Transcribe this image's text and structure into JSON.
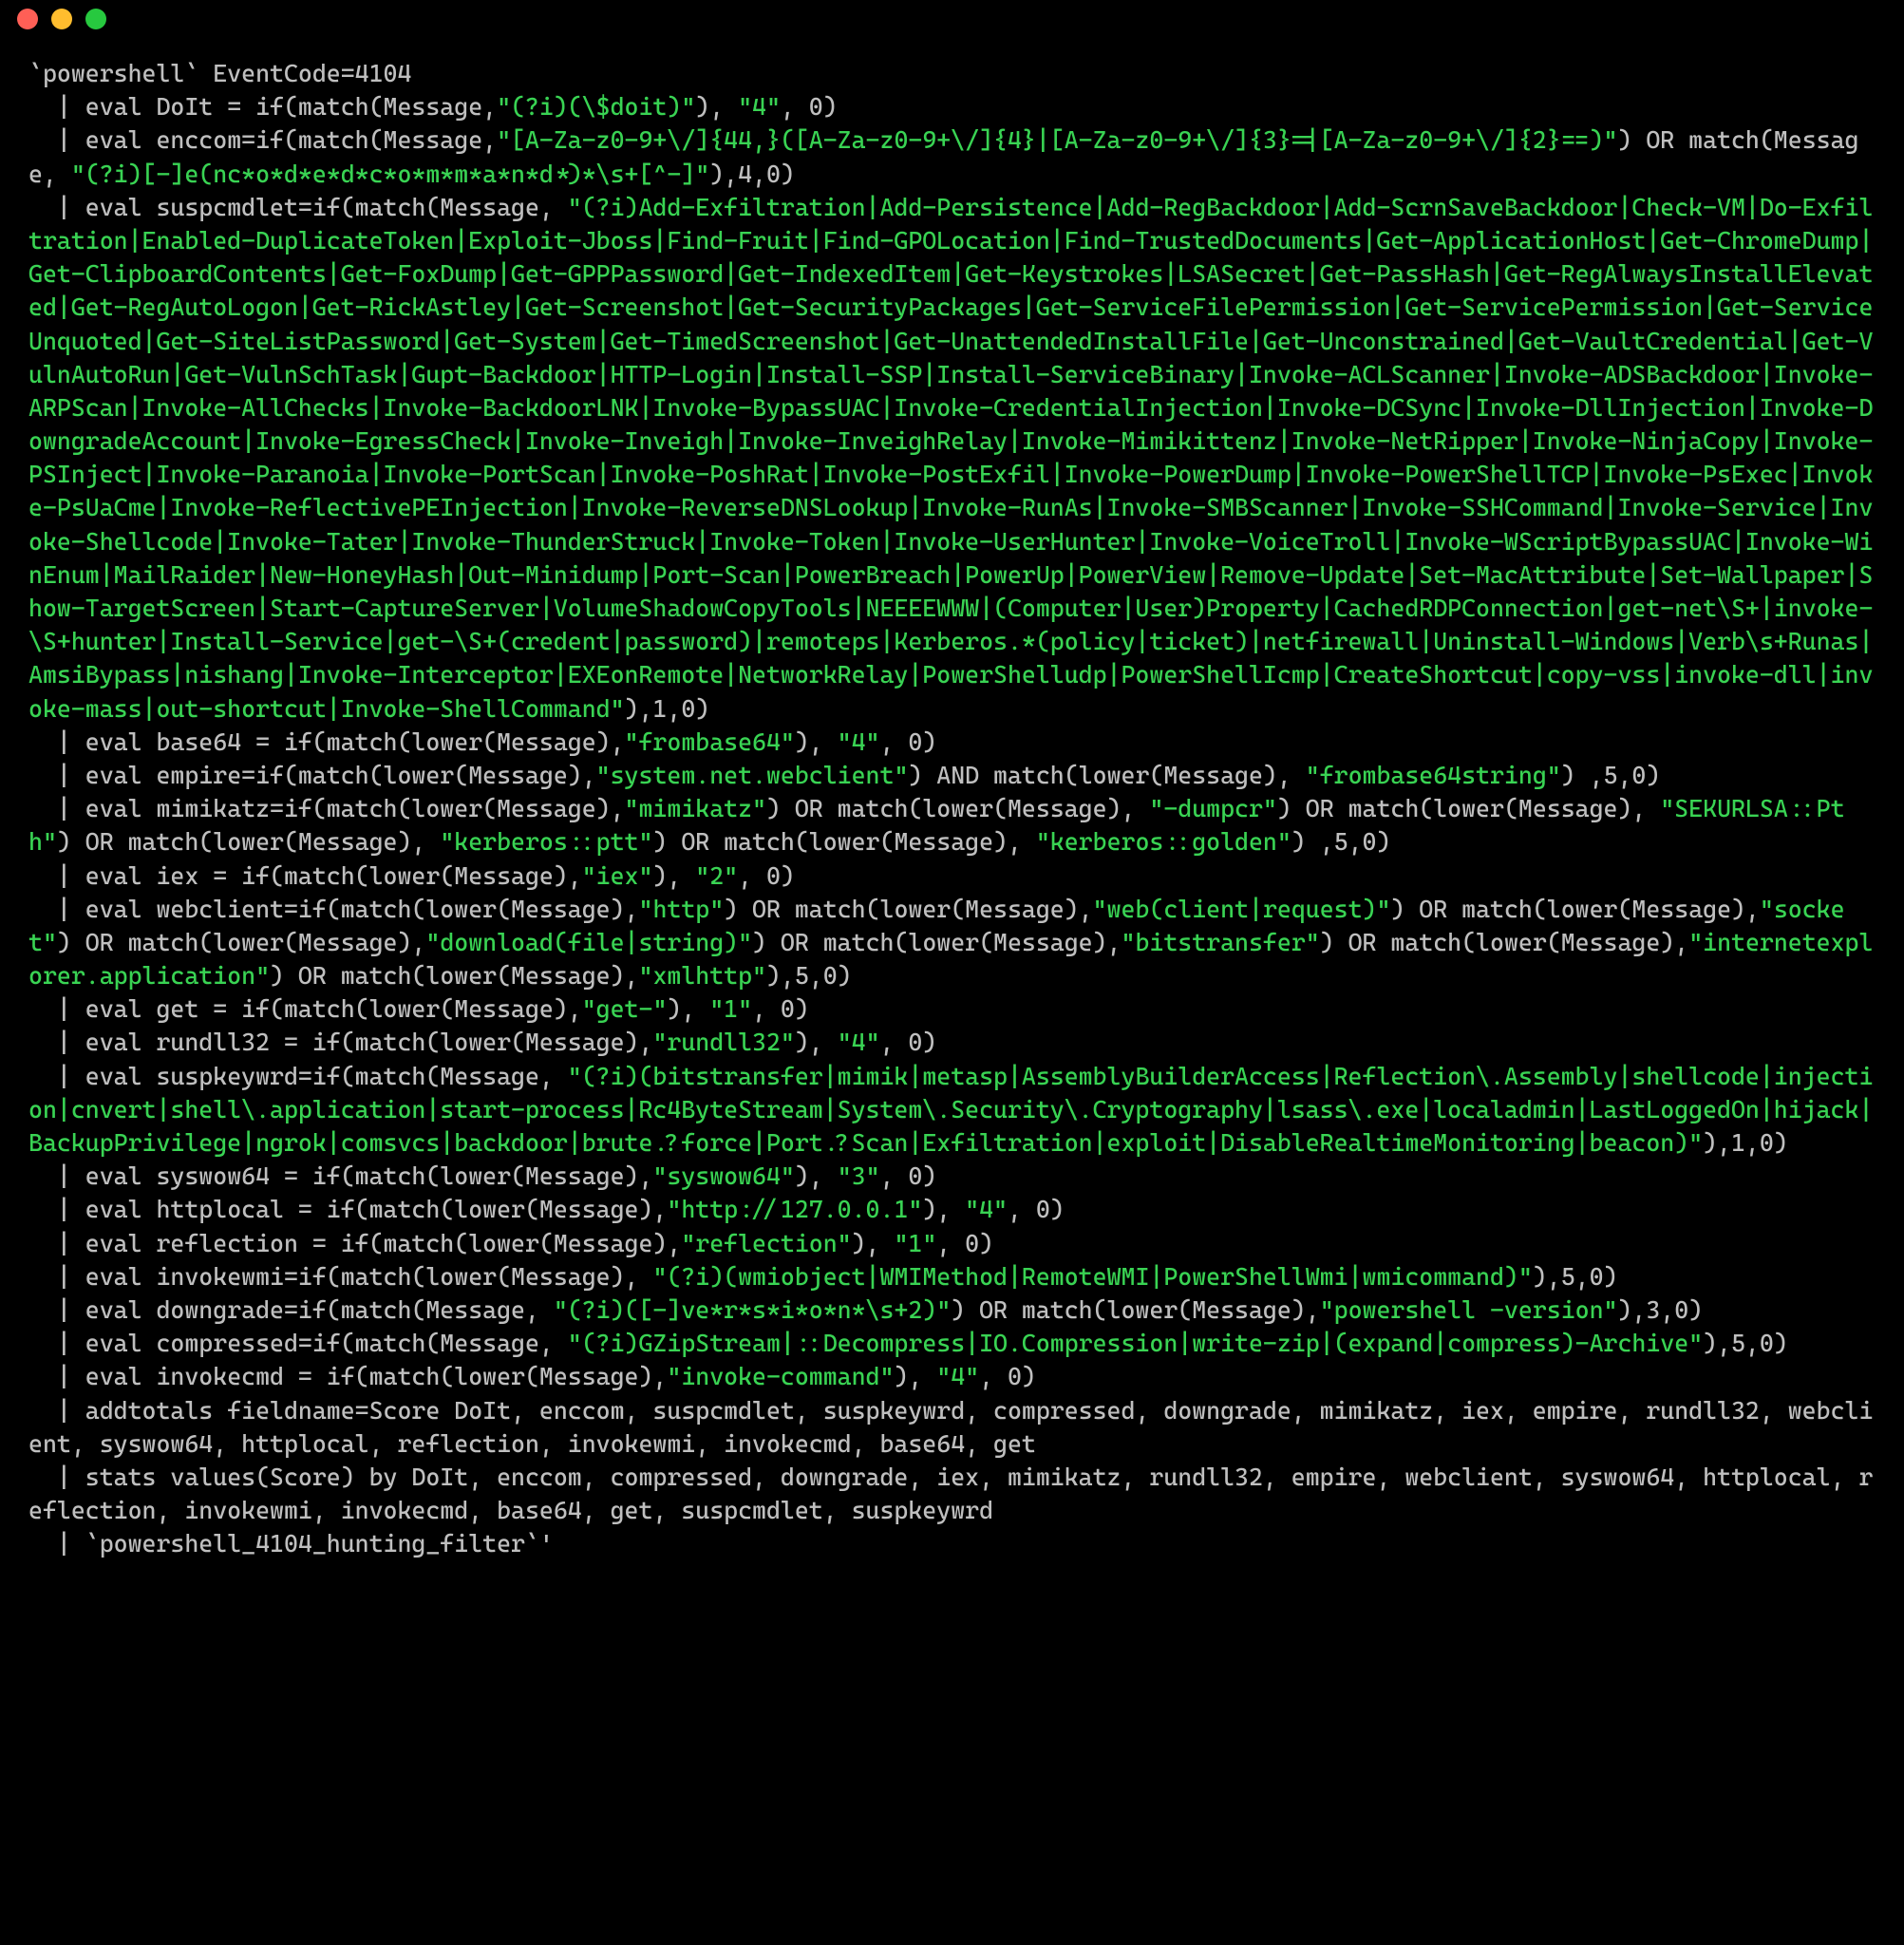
{
  "titlebar": {
    "buttons": [
      "close",
      "minimize",
      "zoom"
    ]
  },
  "code": {
    "tokens": [
      {
        "c": "p",
        "t": "`powershell` EventCode=4104\n  | eval DoIt = if(match(Message,"
      },
      {
        "c": "s",
        "t": "\"(?i)(\\$doit)\""
      },
      {
        "c": "p",
        "t": "), "
      },
      {
        "c": "s",
        "t": "\"4\""
      },
      {
        "c": "p",
        "t": ", 0)\n  | eval enccom=if(match(Message,"
      },
      {
        "c": "s",
        "t": "\"[A-Za-z0-9+\\/]{44,}([A-Za-z0-9+\\/]{4}|[A-Za-z0-9+\\/]{3}=|[A-Za-z0-9+\\/]{2}==)\""
      },
      {
        "c": "p",
        "t": ") OR match(Message, "
      },
      {
        "c": "s",
        "t": "\"(?i)[-]e(nc*o*d*e*d*c*o*m*m*a*n*d*)*\\s+[^-]\""
      },
      {
        "c": "p",
        "t": "),4,0)\n  | eval suspcmdlet=if(match(Message, "
      },
      {
        "c": "s",
        "t": "\"(?i)Add-Exfiltration|Add-Persistence|Add-RegBackdoor|Add-ScrnSaveBackdoor|Check-VM|Do-Exfiltration|Enabled-DuplicateToken|Exploit-Jboss|Find-Fruit|Find-GPOLocation|Find-TrustedDocuments|Get-ApplicationHost|Get-ChromeDump|Get-ClipboardContents|Get-FoxDump|Get-GPPPassword|Get-IndexedItem|Get-Keystrokes|LSASecret|Get-PassHash|Get-RegAlwaysInstallElevated|Get-RegAutoLogon|Get-RickAstley|Get-Screenshot|Get-SecurityPackages|Get-ServiceFilePermission|Get-ServicePermission|Get-ServiceUnquoted|Get-SiteListPassword|Get-System|Get-TimedScreenshot|Get-UnattendedInstallFile|Get-Unconstrained|Get-VaultCredential|Get-VulnAutoRun|Get-VulnSchTask|Gupt-Backdoor|HTTP-Login|Install-SSP|Install-ServiceBinary|Invoke-ACLScanner|Invoke-ADSBackdoor|Invoke-ARPScan|Invoke-AllChecks|Invoke-BackdoorLNK|Invoke-BypassUAC|Invoke-CredentialInjection|Invoke-DCSync|Invoke-DllInjection|Invoke-DowngradeAccount|Invoke-EgressCheck|Invoke-Inveigh|Invoke-InveighRelay|Invoke-Mimikittenz|Invoke-NetRipper|Invoke-NinjaCopy|Invoke-PSInject|Invoke-Paranoia|Invoke-PortScan|Invoke-PoshRat|Invoke-PostExfil|Invoke-PowerDump|Invoke-PowerShellTCP|Invoke-PsExec|Invoke-PsUaCme|Invoke-ReflectivePEInjection|Invoke-ReverseDNSLookup|Invoke-RunAs|Invoke-SMBScanner|Invoke-SSHCommand|Invoke-Service|Invoke-Shellcode|Invoke-Tater|Invoke-ThunderStruck|Invoke-Token|Invoke-UserHunter|Invoke-VoiceTroll|Invoke-WScriptBypassUAC|Invoke-WinEnum|MailRaider|New-HoneyHash|Out-Minidump|Port-Scan|PowerBreach|PowerUp|PowerView|Remove-Update|Set-MacAttribute|Set-Wallpaper|Show-TargetScreen|Start-CaptureServer|VolumeShadowCopyTools|NEEEEWWW|(Computer|User)Property|CachedRDPConnection|get-net\\S+|invoke-\\S+hunter|Install-Service|get-\\S+(credent|password)|remoteps|Kerberos.*(policy|ticket)|netfirewall|Uninstall-Windows|Verb\\s+Runas|AmsiBypass|nishang|Invoke-Interceptor|EXEonRemote|NetworkRelay|PowerShelludp|PowerShellIcmp|CreateShortcut|copy-vss|invoke-dll|invoke-mass|out-shortcut|Invoke-ShellCommand\""
      },
      {
        "c": "p",
        "t": "),1,0)\n  | eval base64 = if(match(lower(Message),"
      },
      {
        "c": "s",
        "t": "\"frombase64\""
      },
      {
        "c": "p",
        "t": "), "
      },
      {
        "c": "s",
        "t": "\"4\""
      },
      {
        "c": "p",
        "t": ", 0)\n  | eval empire=if(match(lower(Message),"
      },
      {
        "c": "s",
        "t": "\"system.net.webclient\""
      },
      {
        "c": "p",
        "t": ") AND match(lower(Message), "
      },
      {
        "c": "s",
        "t": "\"frombase64string\""
      },
      {
        "c": "p",
        "t": ") ,5,0)\n  | eval mimikatz=if(match(lower(Message),"
      },
      {
        "c": "s",
        "t": "\"mimikatz\""
      },
      {
        "c": "p",
        "t": ") OR match(lower(Message), "
      },
      {
        "c": "s",
        "t": "\"-dumpcr\""
      },
      {
        "c": "p",
        "t": ") OR match(lower(Message), "
      },
      {
        "c": "s",
        "t": "\"SEKURLSA::Pth\""
      },
      {
        "c": "p",
        "t": ") OR match(lower(Message), "
      },
      {
        "c": "s",
        "t": "\"kerberos::ptt\""
      },
      {
        "c": "p",
        "t": ") OR match(lower(Message), "
      },
      {
        "c": "s",
        "t": "\"kerberos::golden\""
      },
      {
        "c": "p",
        "t": ") ,5,0)\n  | eval iex = if(match(lower(Message),"
      },
      {
        "c": "s",
        "t": "\"iex\""
      },
      {
        "c": "p",
        "t": "), "
      },
      {
        "c": "s",
        "t": "\"2\""
      },
      {
        "c": "p",
        "t": ", 0)\n  | eval webclient=if(match(lower(Message),"
      },
      {
        "c": "s",
        "t": "\"http\""
      },
      {
        "c": "p",
        "t": ") OR match(lower(Message),"
      },
      {
        "c": "s",
        "t": "\"web(client|request)\""
      },
      {
        "c": "p",
        "t": ") OR match(lower(Message),"
      },
      {
        "c": "s",
        "t": "\"socket\""
      },
      {
        "c": "p",
        "t": ") OR match(lower(Message),"
      },
      {
        "c": "s",
        "t": "\"download(file|string)\""
      },
      {
        "c": "p",
        "t": ") OR match(lower(Message),"
      },
      {
        "c": "s",
        "t": "\"bitstransfer\""
      },
      {
        "c": "p",
        "t": ") OR match(lower(Message),"
      },
      {
        "c": "s",
        "t": "\"internetexplorer.application\""
      },
      {
        "c": "p",
        "t": ") OR match(lower(Message),"
      },
      {
        "c": "s",
        "t": "\"xmlhttp\""
      },
      {
        "c": "p",
        "t": "),5,0)\n  | eval get = if(match(lower(Message),"
      },
      {
        "c": "s",
        "t": "\"get-\""
      },
      {
        "c": "p",
        "t": "), "
      },
      {
        "c": "s",
        "t": "\"1\""
      },
      {
        "c": "p",
        "t": ", 0)\n  | eval rundll32 = if(match(lower(Message),"
      },
      {
        "c": "s",
        "t": "\"rundll32\""
      },
      {
        "c": "p",
        "t": "), "
      },
      {
        "c": "s",
        "t": "\"4\""
      },
      {
        "c": "p",
        "t": ", 0)\n  | eval suspkeywrd=if(match(Message, "
      },
      {
        "c": "s",
        "t": "\"(?i)(bitstransfer|mimik|metasp|AssemblyBuilderAccess|Reflection\\.Assembly|shellcode|injection|cnvert|shell\\.application|start-process|Rc4ByteStream|System\\.Security\\.Cryptography|lsass\\.exe|localadmin|LastLoggedOn|hijack|BackupPrivilege|ngrok|comsvcs|backdoor|brute.?force|Port.?Scan|Exfiltration|exploit|DisableRealtimeMonitoring|beacon)\""
      },
      {
        "c": "p",
        "t": "),1,0)\n  | eval syswow64 = if(match(lower(Message),"
      },
      {
        "c": "s",
        "t": "\"syswow64\""
      },
      {
        "c": "p",
        "t": "), "
      },
      {
        "c": "s",
        "t": "\"3\""
      },
      {
        "c": "p",
        "t": ", 0)\n  | eval httplocal = if(match(lower(Message),"
      },
      {
        "c": "s",
        "t": "\"http://127.0.0.1\""
      },
      {
        "c": "p",
        "t": "), "
      },
      {
        "c": "s",
        "t": "\"4\""
      },
      {
        "c": "p",
        "t": ", 0)\n  | eval reflection = if(match(lower(Message),"
      },
      {
        "c": "s",
        "t": "\"reflection\""
      },
      {
        "c": "p",
        "t": "), "
      },
      {
        "c": "s",
        "t": "\"1\""
      },
      {
        "c": "p",
        "t": ", 0)\n  | eval invokewmi=if(match(lower(Message), "
      },
      {
        "c": "s",
        "t": "\"(?i)(wmiobject|WMIMethod|RemoteWMI|PowerShellWmi|wmicommand)\""
      },
      {
        "c": "p",
        "t": "),5,0)\n  | eval downgrade=if(match(Message, "
      },
      {
        "c": "s",
        "t": "\"(?i)([-]ve*r*s*i*o*n*\\s+2)\""
      },
      {
        "c": "p",
        "t": ") OR match(lower(Message),"
      },
      {
        "c": "s",
        "t": "\"powershell -version\""
      },
      {
        "c": "p",
        "t": "),3,0)\n  | eval compressed=if(match(Message, "
      },
      {
        "c": "s",
        "t": "\"(?i)GZipStream|::Decompress|IO.Compression|write-zip|(expand|compress)-Archive\""
      },
      {
        "c": "p",
        "t": "),5,0)\n  | eval invokecmd = if(match(lower(Message),"
      },
      {
        "c": "s",
        "t": "\"invoke-command\""
      },
      {
        "c": "p",
        "t": "), "
      },
      {
        "c": "s",
        "t": "\"4\""
      },
      {
        "c": "p",
        "t": ", 0)\n  | addtotals fieldname=Score DoIt, enccom, suspcmdlet, suspkeywrd, compressed, downgrade, mimikatz, iex, empire, rundll32, webclient, syswow64, httplocal, reflection, invokewmi, invokecmd, base64, get\n  | stats values(Score) by DoIt, enccom, compressed, downgrade, iex, mimikatz, rundll32, empire, webclient, syswow64, httplocal, reflection, invokewmi, invokecmd, base64, get, suspcmdlet, suspkeywrd\n  | `powershell_4104_hunting_filter`'"
      }
    ]
  }
}
